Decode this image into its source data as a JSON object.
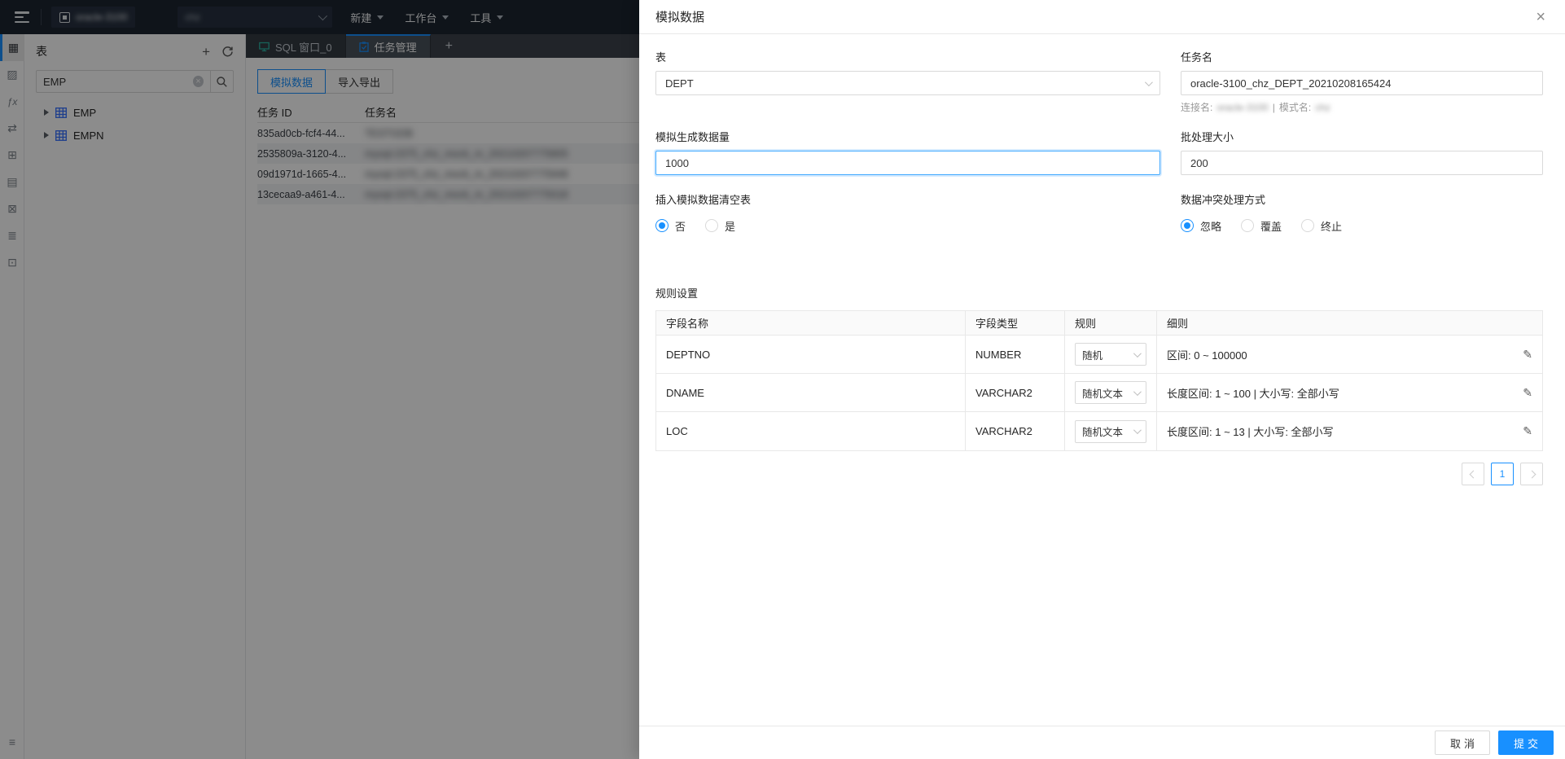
{
  "topbar": {
    "connection_name_redacted": "oracle-3100",
    "db_selector_value_redacted": "chz",
    "menus": [
      {
        "label": "新建"
      },
      {
        "label": "工作台"
      },
      {
        "label": "工具"
      }
    ]
  },
  "sidebar": {
    "icons": [
      {
        "name": "table-icon",
        "glyph": "▦"
      },
      {
        "name": "view-icon",
        "glyph": "▨"
      },
      {
        "name": "function-icon",
        "glyph": "ƒx"
      },
      {
        "name": "sync-icon",
        "glyph": "⇄"
      },
      {
        "name": "grid-plus-icon",
        "glyph": "⊞"
      },
      {
        "name": "document-icon",
        "glyph": "▤"
      },
      {
        "name": "close-square-icon",
        "glyph": "⊠"
      },
      {
        "name": "ordered-list-icon",
        "glyph": "≣"
      },
      {
        "name": "copy-icon",
        "glyph": "⊡"
      }
    ],
    "bottom_icon": {
      "name": "list-icon",
      "glyph": "≡"
    }
  },
  "explorer": {
    "title": "表",
    "search_value": "EMP",
    "tree": [
      {
        "label": "EMP"
      },
      {
        "label": "EMPN"
      }
    ]
  },
  "tabs": [
    {
      "label": "SQL 窗口_0"
    },
    {
      "label": "任务管理"
    }
  ],
  "toolbar": {
    "mock_data_label": "模拟数据",
    "import_export_label": "导入导出"
  },
  "task_table": {
    "col_id": "任务 ID",
    "col_name": "任务名",
    "rows": [
      {
        "id": "835ad0cb-fcf4-44...",
        "name_redacted": "TESTGDB"
      },
      {
        "id": "2535809a-3120-4...",
        "name_redacted": "mysql-2375_chz_mock_m_20210207775805"
      },
      {
        "id": "09d1971d-1665-4...",
        "name_redacted": "mysql-2375_chz_mock_m_20210207775948"
      },
      {
        "id": "13cecaa9-a461-4...",
        "name_redacted": "mysql-2375_chz_mock_m_20210207775018"
      }
    ]
  },
  "drawer": {
    "title": "模拟数据",
    "table_label": "表",
    "table_value": "DEPT",
    "task_name_label": "任务名",
    "task_name_value": "oracle-3100_chz_DEPT_20210208165424",
    "helper": {
      "conn_label": "连接名:",
      "conn_value_redacted": "oracle-3100",
      "separator": "|",
      "schema_label": "模式名:",
      "schema_value_redacted": "chz"
    },
    "rows_label": "模拟生成数据量",
    "rows_value": "1000",
    "batch_label": "批处理大小",
    "batch_value": "200",
    "truncate_label": "插入模拟数据清空表",
    "truncate_options": [
      {
        "label": "否",
        "selected": true
      },
      {
        "label": "是",
        "selected": false
      }
    ],
    "conflict_label": "数据冲突处理方式",
    "conflict_options": [
      {
        "label": "忽略",
        "selected": true
      },
      {
        "label": "覆盖",
        "selected": false
      },
      {
        "label": "终止",
        "selected": false
      }
    ],
    "rules": {
      "section_title": "规则设置",
      "columns": {
        "name": "字段名称",
        "type": "字段类型",
        "rule": "规则",
        "detail": "细则"
      },
      "rows": [
        {
          "name": "DEPTNO",
          "type": "NUMBER",
          "rule": "随机",
          "detail": "区间: 0 ~ 100000"
        },
        {
          "name": "DNAME",
          "type": "VARCHAR2",
          "rule": "随机文本",
          "detail": "长度区间: 1 ~ 100 | 大小写: 全部小写"
        },
        {
          "name": "LOC",
          "type": "VARCHAR2",
          "rule": "随机文本",
          "detail": "长度区间: 1 ~ 13 | 大小写: 全部小写"
        }
      ]
    },
    "pagination": {
      "current_page": "1"
    },
    "footer": {
      "cancel_label": "取消",
      "submit_label": "提交"
    }
  }
}
